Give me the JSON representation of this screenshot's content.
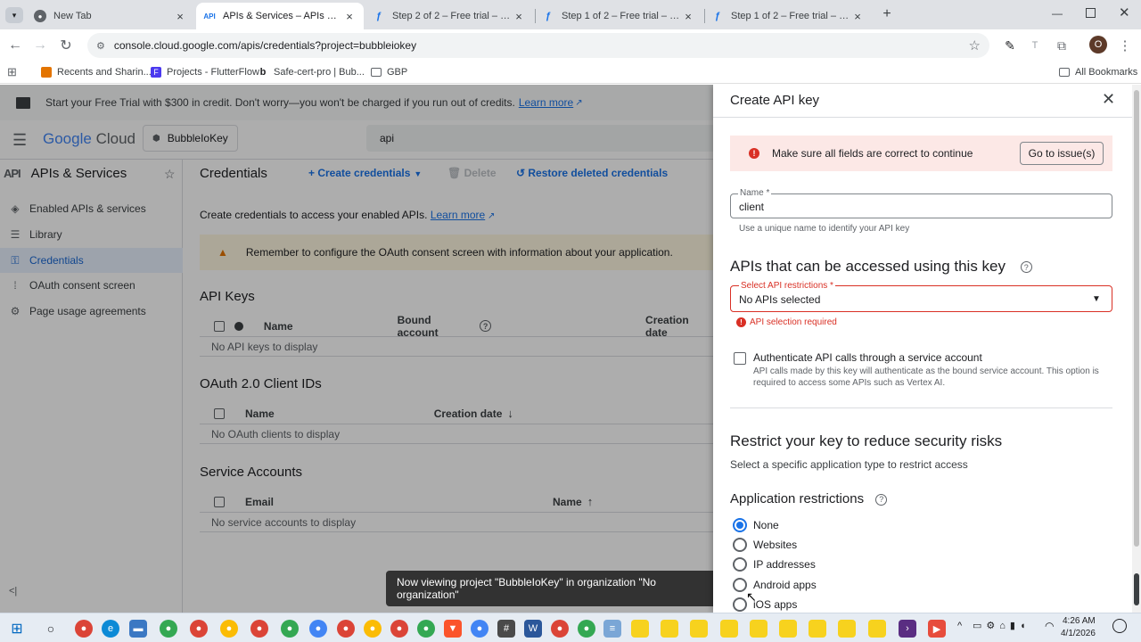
{
  "browser": {
    "tabs": [
      {
        "title": "New Tab",
        "icon": "chrome-icon",
        "active": false
      },
      {
        "title": "APIs & Services – APIs & Servic",
        "icon": "api-icon",
        "active": true
      },
      {
        "title": "Step 2 of 2 – Free trial – Google",
        "icon": "feather-icon",
        "active": false
      },
      {
        "title": "Step 1 of 2 – Free trial – Google",
        "icon": "feather-icon",
        "active": false
      },
      {
        "title": "Step 1 of 2 – Free trial – Google",
        "icon": "feather-icon",
        "active": false
      }
    ],
    "new_tab_glyph": "+",
    "url": "console.cloud.google.com/apis/credentials?project=bubbleiokey",
    "profile_initial": "O",
    "bookmarks": [
      {
        "label": "Recents and Sharin...",
        "color": "#e37400"
      },
      {
        "label": "Projects - FlutterFlow",
        "color": "#4b39ef"
      },
      {
        "label": "Safe-cert-pro | Bub...",
        "color": "#202124"
      },
      {
        "label": "GBP",
        "color": "#5f6368"
      }
    ],
    "all_bookmarks": "All Bookmarks"
  },
  "banner": {
    "text": "Start your Free Trial with $300 in credit. Don't worry—you won't be charged if you run out of credits.",
    "link": "Learn more"
  },
  "header": {
    "logo_google": "Google",
    "logo_cloud": "Cloud",
    "project": "BubbleIoKey",
    "search_value": "api"
  },
  "sidebar": {
    "section_icon": "API",
    "section_title": "APIs & Services",
    "items": [
      {
        "label": "Enabled APIs & services",
        "icon": "◈"
      },
      {
        "label": "Library",
        "icon": "☰"
      },
      {
        "label": "Credentials",
        "icon": "⚿"
      },
      {
        "label": "OAuth consent screen",
        "icon": "⁞"
      },
      {
        "label": "Page usage agreements",
        "icon": "⚙"
      }
    ],
    "collapse_glyph": "<|"
  },
  "main": {
    "title": "Credentials",
    "create_credentials": "Create credentials",
    "delete": "Delete",
    "restore": "Restore deleted credentials",
    "intro": "Create credentials to access your enabled APIs.",
    "intro_link": "Learn more",
    "warning": "Remember to configure the OAuth consent screen with information about your application.",
    "api_keys": {
      "title": "API Keys",
      "columns": [
        "Name",
        "Bound account",
        "Creation date"
      ],
      "empty": "No API keys to display"
    },
    "oauth": {
      "title": "OAuth 2.0 Client IDs",
      "columns": [
        "Name",
        "Creation date"
      ],
      "empty": "No OAuth clients to display"
    },
    "service_accounts": {
      "title": "Service Accounts",
      "columns": [
        "Email",
        "Name"
      ],
      "empty": "No service accounts to display"
    }
  },
  "panel": {
    "title": "Create API key",
    "error_banner": "Make sure all fields are correct to continue",
    "go_to_issues": "Go to issue(s)",
    "name_label": "Name *",
    "name_value": "client",
    "name_hint": "Use a unique name to identify your API key",
    "apis_heading": "APIs that can be accessed using this key",
    "select_label": "Select API restrictions *",
    "select_value": "No APIs selected",
    "select_error": "API selection required",
    "auth_label": "Authenticate API calls through a service account",
    "auth_desc": "API calls made by this key will authenticate as the bound service account. This option is required to access some APIs such as Vertex AI.",
    "restrict_heading": "Restrict your key to reduce security risks",
    "restrict_sub": "Select a specific application type to restrict access",
    "app_restrictions_heading": "Application restrictions",
    "options": [
      "None",
      "Websites",
      "IP addresses",
      "Android apps",
      "iOS apps"
    ],
    "selected_option": "None"
  },
  "toast": "Now viewing project \"BubbleIoKey\" in organization \"No organization\"",
  "taskbar": {
    "time": "4:26 AM",
    "date": "4/1/2026"
  },
  "colors": {
    "accent": "#1a73e8",
    "error": "#d93025",
    "warning": "#e37400",
    "error_bg": "#fce8e6",
    "warning_bg": "#fef7e0"
  }
}
